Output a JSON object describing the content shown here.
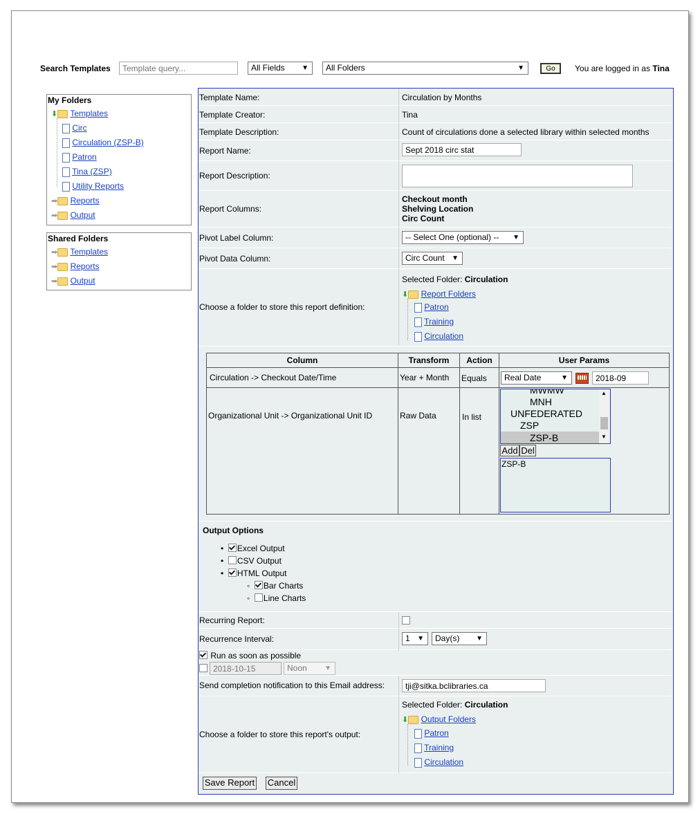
{
  "header": {
    "search_label": "Search Templates",
    "search_placeholder": "Template query...",
    "field_select": "All Fields",
    "folder_select": "All Folders",
    "go_label": "Go",
    "login_prefix": "You are logged in as",
    "user": "Tina"
  },
  "my_folders": {
    "title": "My Folders",
    "templates": "Templates",
    "template_items": [
      "Circ",
      "Circulation (ZSP-B)",
      "Patron",
      "Tina (ZSP)",
      "Utility Reports"
    ],
    "reports": "Reports",
    "output": "Output"
  },
  "shared_folders": {
    "title": "Shared Folders",
    "templates": "Templates",
    "reports": "Reports",
    "output": "Output"
  },
  "form": {
    "template_name_label": "Template Name:",
    "template_name": "Circulation by Months",
    "template_creator_label": "Template Creator:",
    "template_creator": "Tina",
    "template_desc_label": "Template Description:",
    "template_desc": "Count of circulations done a selected library within selected months",
    "report_name_label": "Report Name:",
    "report_name": "Sept 2018 circ stat",
    "report_desc_label": "Report Description:",
    "report_desc": "",
    "report_columns_label": "Report Columns:",
    "report_columns": [
      "Checkout month",
      "Shelving Location",
      "Circ Count"
    ],
    "pivot_label_label": "Pivot Label Column:",
    "pivot_label_value": "-- Select One (optional) --",
    "pivot_data_label": "Pivot Data Column:",
    "pivot_data_value": "Circ Count",
    "folder_choose_label": "Choose a folder to store this report definition:",
    "selected_folder_prefix": "Selected Folder:",
    "selected_folder": "Circulation",
    "report_folders": "Report Folders",
    "report_folder_items": [
      "Patron",
      "Training",
      "Circulation"
    ]
  },
  "params": {
    "headers": [
      "Column",
      "Transform",
      "Action",
      "User Params"
    ],
    "row1": {
      "column": "Circulation -> Checkout Date/Time",
      "transform": "Year + Month",
      "action": "Equals",
      "date_type": "Real Date",
      "date_value": "2018-09"
    },
    "row2": {
      "column": "Organizational Unit -> Organizational Unit ID",
      "transform": "Raw Data",
      "action": "In list",
      "list_items": [
        "MWMW",
        "MNH",
        "UNFEDERATED",
        "ZSP",
        "ZSP-B"
      ],
      "add_label": "Add",
      "del_label": "Del",
      "selected_items": [
        "ZSP-B"
      ]
    }
  },
  "output_options": {
    "title": "Output Options",
    "excel": "Excel Output",
    "csv": "CSV Output",
    "html": "HTML Output",
    "bar": "Bar Charts",
    "line": "Line Charts"
  },
  "schedule": {
    "recurring_label": "Recurring Report:",
    "interval_label": "Recurrence Interval:",
    "interval_num": "1",
    "interval_unit": "Day(s)",
    "run_asap": "Run as soon as possible",
    "run_date": "2018-10-15",
    "run_time": "Noon",
    "email_label": "Send completion notification to this Email address:",
    "email": "tji@sitka.bclibraries.ca",
    "output_folder_label": "Choose a folder to store this report's output:",
    "output_selected_prefix": "Selected Folder:",
    "output_selected": "Circulation",
    "output_folders": "Output Folders",
    "output_folder_items": [
      "Patron",
      "Training",
      "Circulation"
    ]
  },
  "actions": {
    "save": "Save Report",
    "cancel": "Cancel"
  }
}
